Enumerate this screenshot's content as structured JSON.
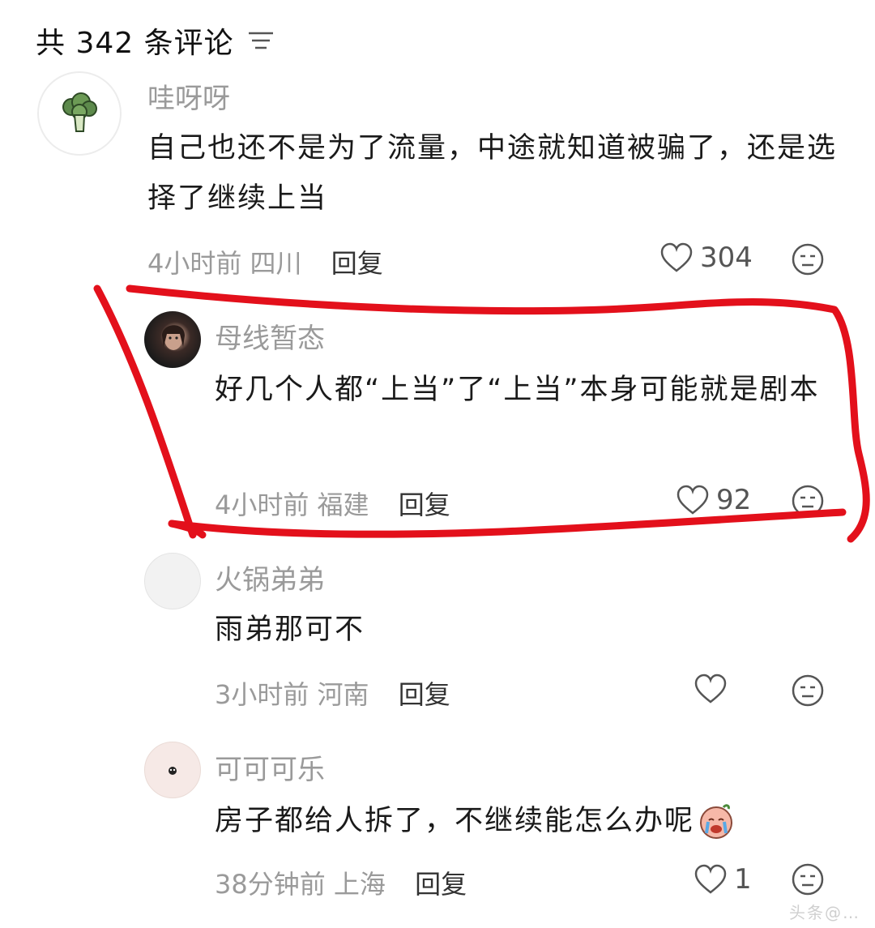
{
  "header": {
    "title": "共 342 条评论",
    "filter_icon": "filter-lines-icon"
  },
  "comments": [
    {
      "username": "哇呀呀",
      "avatar_icon": "broccoli-avatar",
      "content": "自己也还不是为了流量，中途就知道被骗了，还是选择了继续上当",
      "time": "4小时前",
      "location": "四川",
      "reply_label": "回复",
      "likes": "304"
    },
    {
      "username": "母线暂态",
      "avatar_icon": "portrait-avatar",
      "content": "好几个人都“上当”了“上当”本身可能就是剧本",
      "time": "4小时前",
      "location": "福建",
      "reply_label": "回复",
      "likes": "92"
    },
    {
      "username": "火锅弟弟",
      "avatar_icon": "blank-avatar",
      "content": "雨弟那可不",
      "time": "3小时前",
      "location": "河南",
      "reply_label": "回复",
      "likes": ""
    },
    {
      "username": "可可可乐",
      "avatar_icon": "bug-avatar",
      "content": "房子都给人拆了，不继续能怎么办呢",
      "emoji": "crying-face-emoji",
      "time": "38分钟前",
      "location": "上海",
      "reply_label": "回复",
      "likes": "1"
    }
  ],
  "colors": {
    "annotation_red": "#e3101b",
    "muted": "#9a9a9a"
  },
  "watermark": "头条@…"
}
